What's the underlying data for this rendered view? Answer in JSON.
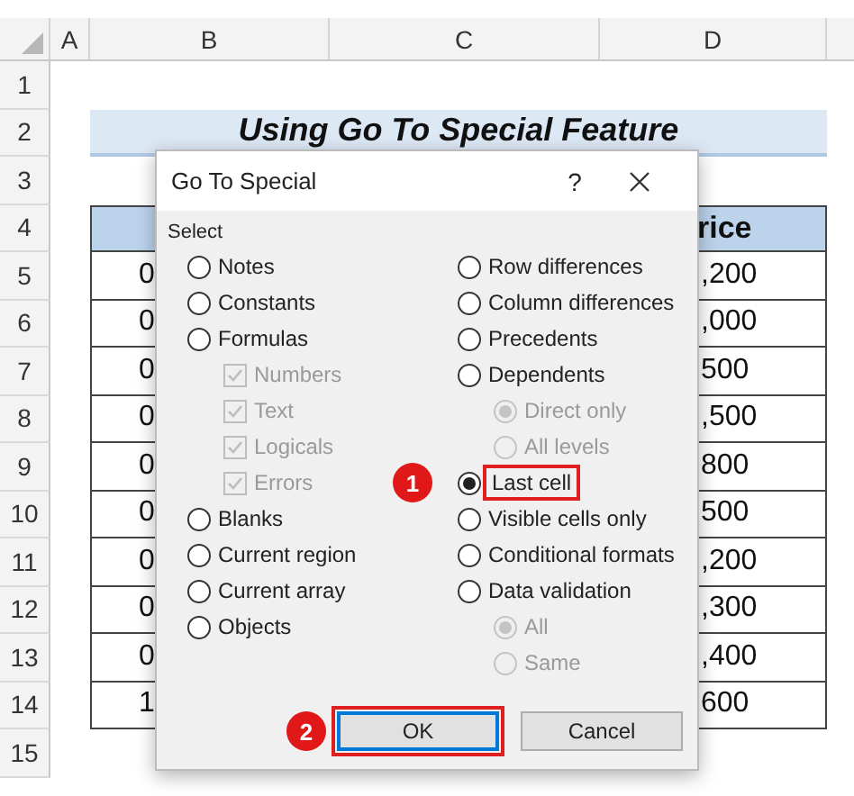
{
  "spreadsheet": {
    "columns": [
      "A",
      "B",
      "C",
      "D"
    ],
    "rows": [
      "1",
      "2",
      "3",
      "4",
      "5",
      "6",
      "7",
      "8",
      "9",
      "10",
      "11",
      "12",
      "13",
      "14",
      "15"
    ],
    "title": "Using Go To Special Feature",
    "table": {
      "header_d": "rice",
      "rows": [
        {
          "column_b": "0",
          "column_d": ",200"
        },
        {
          "column_b": "0",
          "column_d": ",000"
        },
        {
          "column_b": "0",
          "column_d": "500"
        },
        {
          "column_b": "0",
          "column_d": ",500"
        },
        {
          "column_b": "0",
          "column_d": "800"
        },
        {
          "column_b": "0",
          "column_d": "500"
        },
        {
          "column_b": "0",
          "column_d": ",200"
        },
        {
          "column_b": "0",
          "column_d": ",300"
        },
        {
          "column_b": "0",
          "column_d": ",400"
        },
        {
          "column_b": "1",
          "column_d": "600"
        }
      ]
    }
  },
  "dialog": {
    "title": "Go To Special",
    "help": "?",
    "group_label": "Select",
    "left_options": [
      {
        "kind": "radio",
        "label": "Notes",
        "selected": false,
        "disabled": false
      },
      {
        "kind": "radio",
        "label": "Constants",
        "selected": false,
        "disabled": false
      },
      {
        "kind": "radio",
        "label": "Formulas",
        "selected": false,
        "disabled": false,
        "children": [
          {
            "kind": "checkbox",
            "label": "Numbers",
            "checked": true,
            "disabled": true
          },
          {
            "kind": "checkbox",
            "label": "Text",
            "checked": true,
            "disabled": true
          },
          {
            "kind": "checkbox",
            "label": "Logicals",
            "checked": true,
            "disabled": true
          },
          {
            "kind": "checkbox",
            "label": "Errors",
            "checked": true,
            "disabled": true
          }
        ]
      },
      {
        "kind": "radio",
        "label": "Blanks",
        "selected": false,
        "disabled": false
      },
      {
        "kind": "radio",
        "label": "Current region",
        "selected": false,
        "disabled": false
      },
      {
        "kind": "radio",
        "label": "Current array",
        "selected": false,
        "disabled": false
      },
      {
        "kind": "radio",
        "label": "Objects",
        "selected": false,
        "disabled": false
      }
    ],
    "right_options": [
      {
        "kind": "radio",
        "label": "Row differences",
        "selected": false,
        "disabled": false
      },
      {
        "kind": "radio",
        "label": "Column differences",
        "selected": false,
        "disabled": false
      },
      {
        "kind": "radio",
        "label": "Precedents",
        "selected": false,
        "disabled": false
      },
      {
        "kind": "radio",
        "label": "Dependents",
        "selected": false,
        "disabled": false,
        "children": [
          {
            "kind": "radio",
            "label": "Direct only",
            "selected": true,
            "disabled": true
          },
          {
            "kind": "radio",
            "label": "All levels",
            "selected": false,
            "disabled": true
          }
        ]
      },
      {
        "kind": "radio",
        "label": "Last cell",
        "selected": true,
        "disabled": false,
        "annotation": "1"
      },
      {
        "kind": "radio",
        "label": "Visible cells only",
        "selected": false,
        "disabled": false
      },
      {
        "kind": "radio",
        "label": "Conditional formats",
        "selected": false,
        "disabled": false
      },
      {
        "kind": "radio",
        "label": "Data validation",
        "selected": false,
        "disabled": false,
        "children": [
          {
            "kind": "radio",
            "label": "All",
            "selected": true,
            "disabled": true
          },
          {
            "kind": "radio",
            "label": "Same",
            "selected": false,
            "disabled": true
          }
        ]
      }
    ],
    "buttons": [
      {
        "label": "OK",
        "default": true,
        "annotation": "2"
      },
      {
        "label": "Cancel",
        "default": false
      }
    ]
  }
}
